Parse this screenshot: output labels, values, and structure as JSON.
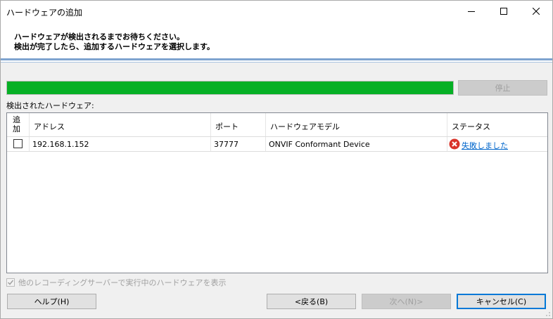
{
  "window": {
    "title": "ハードウェアの追加",
    "minimize_icon": "minimize-icon",
    "maximize_icon": "maximize-icon",
    "close_icon": "close-icon"
  },
  "header": {
    "line1": "ハードウェアが検出されるまでお待ちください。",
    "line2": "検出が完了したら、追加するハードウェアを選択します。"
  },
  "progress": {
    "fraction": 1.0,
    "color": "#06b025"
  },
  "stop_button": "停止",
  "list": {
    "label": "検出されたハードウェア:",
    "columns": [
      "追加",
      "アドレス",
      "ポート",
      "ハードウェアモデル",
      "ステータス"
    ],
    "rows": [
      {
        "checked": false,
        "address": "192.168.1.152",
        "port": "37777",
        "model": "ONVIF Conformant Device",
        "status": "失敗しました",
        "status_icon": "error-icon"
      }
    ]
  },
  "show_others": {
    "label": "他のレコーディングサーバーで実行中のハードウェアを表示",
    "checked": true,
    "enabled": false
  },
  "buttons": {
    "help": "ヘルプ(H)",
    "back": "<戻る(B)",
    "next": "次へ(N)>",
    "cancel": "キャンセル(C)"
  },
  "colors": {
    "accent": "#0078d7",
    "error": "#d9342b",
    "link": "#0066cc",
    "progress": "#06b025"
  }
}
